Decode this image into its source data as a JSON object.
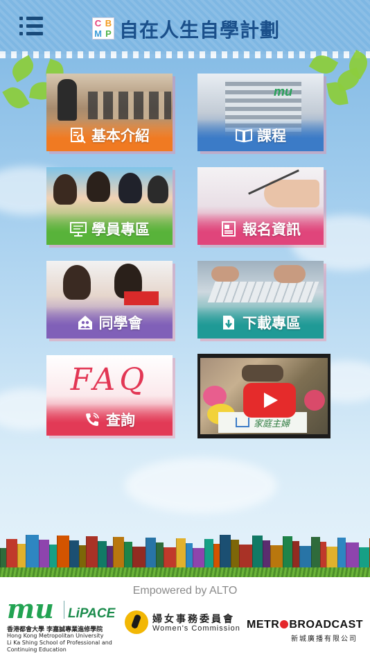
{
  "header": {
    "title": "自在人生自學計劃",
    "logo_letters": [
      "C",
      "B",
      "M",
      "P"
    ],
    "menu_icon": "hamburger-list-icon",
    "background_color": "#7eb7e3",
    "title_color": "#1a4f8a"
  },
  "tiles": [
    {
      "label": "基本介紹",
      "icon": "document-search-icon",
      "band_color": "#f07a22"
    },
    {
      "label": "課程",
      "icon": "open-book-icon",
      "band_color": "#3b7bc7"
    },
    {
      "label": "學員專區",
      "icon": "monitor-icon",
      "band_color": "#58b33a"
    },
    {
      "label": "報名資訊",
      "icon": "id-card-icon",
      "band_color": "#e0457b"
    },
    {
      "label": "同學會",
      "icon": "house-people-icon",
      "band_color": "#8060b8"
    },
    {
      "label": "下載專區",
      "icon": "download-file-icon",
      "band_color": "#1f9a96"
    },
    {
      "label": "查詢",
      "icon": "phone-icon",
      "band_color": "#e23a56"
    }
  ],
  "faq": {
    "text": "FAQ"
  },
  "video": {
    "sign_text": "家庭主婦",
    "play_color": "#e52b2b"
  },
  "footer": {
    "empowered_text": "Empowered by ALTO",
    "sponsors": {
      "hkmu": {
        "mark": "mu",
        "lipace": "LiPACE",
        "line1": "香港都會大學 李嘉誠專業進修學院",
        "line2": "Hong Kong Metropolitan University",
        "line3": "Li Ka Shing School of Professional and",
        "line4": "Continuing Education"
      },
      "womens_commission": {
        "zh": "婦女事務委員會",
        "en": "Women's Commission"
      },
      "metro": {
        "en_prefix": "METR",
        "en_suffix": "BROADCAST",
        "zh": "新城廣播有限公司"
      }
    }
  }
}
